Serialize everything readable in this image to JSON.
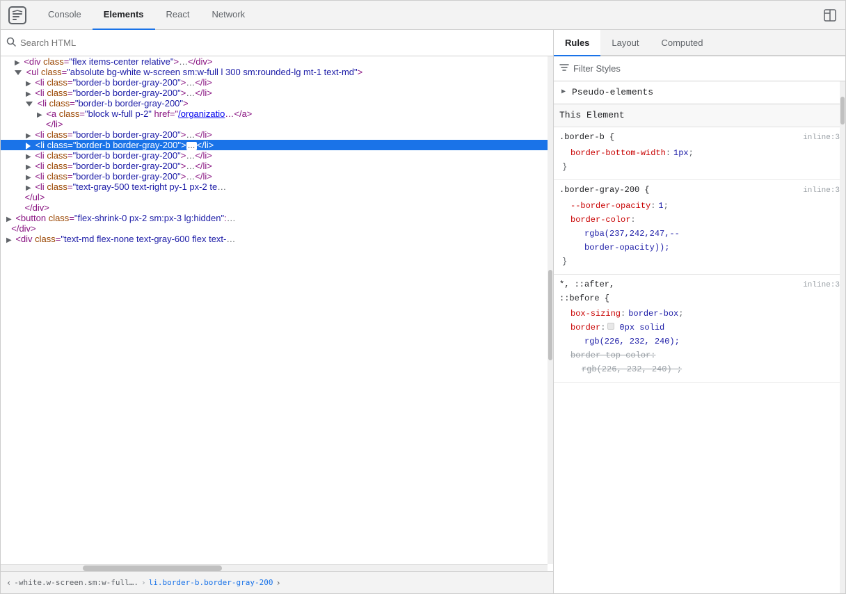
{
  "tabs": {
    "items": [
      {
        "label": "Console",
        "active": false
      },
      {
        "label": "Elements",
        "active": true
      },
      {
        "label": "React",
        "active": false
      },
      {
        "label": "Network",
        "active": false
      }
    ],
    "end_icon": "layout-icon"
  },
  "search": {
    "placeholder": "Search HTML"
  },
  "dom": {
    "lines": [
      {
        "indent": 1,
        "html": "<div class=\"flex items-center relative\">…</div>",
        "type": "collapsed",
        "id": "l1"
      },
      {
        "indent": 1,
        "html": "<ul class=\"absolute bg-white w-screen sm:w-full l 300 sm:rounded-lg mt-1 text-md\">",
        "type": "open",
        "id": "l2"
      },
      {
        "indent": 2,
        "html": "<li class=\"border-b border-gray-200\">…</li>",
        "type": "collapsed",
        "id": "l3"
      },
      {
        "indent": 2,
        "html": "<li class=\"border-b border-gray-200\">…</li>",
        "type": "collapsed",
        "id": "l4"
      },
      {
        "indent": 2,
        "html": "<li class=\"border-b border-gray-200\">",
        "type": "open",
        "id": "l5"
      },
      {
        "indent": 3,
        "html": "<a class=\"block w-full p-2\" href=\"/organizatio…</a>",
        "type": "collapsed",
        "id": "l6"
      },
      {
        "indent": 2,
        "html": "</li>",
        "type": "close",
        "id": "l7"
      },
      {
        "indent": 2,
        "html": "<li class=\"border-b border-gray-200\">…</li>",
        "type": "collapsed",
        "id": "l8"
      },
      {
        "indent": 2,
        "html": "<li class=\"border-b border-gray-200\">…</li>",
        "type": "selected",
        "id": "l9"
      },
      {
        "indent": 2,
        "html": "<li class=\"border-b border-gray-200\">…</li>",
        "type": "collapsed",
        "id": "l10"
      },
      {
        "indent": 2,
        "html": "<li class=\"border-b border-gray-200\">…</li>",
        "type": "collapsed",
        "id": "l11"
      },
      {
        "indent": 2,
        "html": "<li class=\"border-b border-gray-200\">…</li>",
        "type": "collapsed",
        "id": "l12"
      },
      {
        "indent": 2,
        "html": "<li class=\"text-gray-500 text-right py-1 px-2 te…",
        "type": "collapsed",
        "id": "l13"
      },
      {
        "indent": 1,
        "html": "</ul>",
        "type": "close",
        "id": "l14"
      },
      {
        "indent": 1,
        "html": "</div>",
        "type": "close",
        "id": "l15"
      },
      {
        "indent": 0,
        "html": "<button class=\"flex-shrink-0 px-2 sm:px-3 lg:hidden\":…",
        "type": "collapsed",
        "id": "l16"
      },
      {
        "indent": 0,
        "html": "</div>",
        "type": "close",
        "id": "l17"
      },
      {
        "indent": 0,
        "html": "<div class=\"text-md flex-none text-gray-600 flex text-…",
        "type": "collapsed",
        "id": "l18"
      }
    ]
  },
  "breadcrumb": {
    "back_label": "‹",
    "forward_label": "›",
    "path": "-white.w-screen.sm:w-full….",
    "separator": "›",
    "current": "li.border-b.border-gray-200"
  },
  "styles_panel": {
    "tabs": [
      {
        "label": "Rules",
        "active": true
      },
      {
        "label": "Layout",
        "active": false
      },
      {
        "label": "Computed",
        "active": false
      }
    ],
    "filter_placeholder": "Filter Styles",
    "pseudo_elements_label": "Pseudo-elements",
    "this_element_label": "This Element",
    "rule_blocks": [
      {
        "id": "rb1",
        "selector": ".border-b {",
        "source": "inline:3",
        "properties": [
          {
            "name": "border-bottom-width",
            "value": "1px",
            "semi": ";",
            "strikethrough": false
          }
        ],
        "close": "}"
      },
      {
        "id": "rb2",
        "selector": ".border-gray-200 {",
        "source": "inline:3",
        "properties": [
          {
            "name": "--border-opacity",
            "value": "1",
            "semi": ";",
            "strikethrough": false
          },
          {
            "name": "border-color",
            "value": "",
            "semi": "",
            "strikethrough": false
          },
          {
            "name_continuation": "",
            "value": "rgba(237,242,247,--",
            "strikethrough": false
          },
          {
            "name_continuation": "",
            "value": "border-opacity));",
            "strikethrough": false
          }
        ],
        "close": "}"
      },
      {
        "id": "rb3",
        "selector": "*, ::after,\n::before {",
        "source": "inline:3",
        "properties": [
          {
            "name": "box-sizing",
            "value": "border-box",
            "semi": ";",
            "strikethrough": false
          },
          {
            "name": "border",
            "value": "0px solid",
            "has_swatch": true,
            "swatch_color": "#e8e8e8",
            "semi": "",
            "strikethrough": false
          },
          {
            "name_continuation": "",
            "value": "rgb(226, 232, 240);",
            "strikethrough": false
          },
          {
            "name": "border top color",
            "value": "rgb(226, 232, 240) ;",
            "strikethrough": true
          }
        ],
        "close": ""
      }
    ]
  }
}
